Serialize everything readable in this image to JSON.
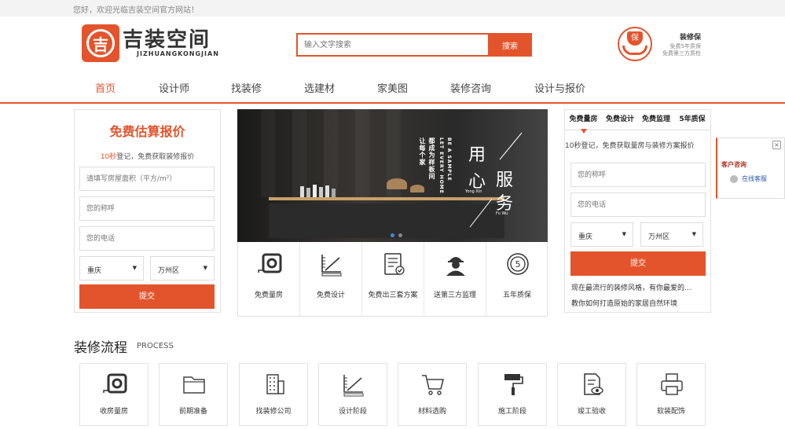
{
  "topbar": {
    "welcome": "您好，欢迎光临吉装空间官方网站！"
  },
  "logo": {
    "glyph": "吉",
    "name_cn": "吉装空间",
    "name_en": "JIZHUANGKONGJIAN"
  },
  "search": {
    "placeholder": "输入文字搜索",
    "button": "搜索"
  },
  "guarantee": {
    "badge": "保",
    "title": "装修保",
    "line1": "免费5年质保",
    "line2": "免费第三方质检"
  },
  "nav": {
    "items": [
      {
        "label": "首页",
        "active": true
      },
      {
        "label": "设计师"
      },
      {
        "label": "找装修"
      },
      {
        "label": "选建材"
      },
      {
        "label": "家美图"
      },
      {
        "label": "装修咨询"
      },
      {
        "label": "设计与报价"
      }
    ]
  },
  "left_form": {
    "title": "免费估算报价",
    "sub_highlight": "10秒",
    "sub_rest": "登记，免费获取装修报价",
    "area_placeholder": "请填写房屋面积（平方/m²）",
    "name_placeholder": "您的称呼",
    "phone_placeholder": "您的电话",
    "city": "重庆",
    "district": "万州区",
    "submit": "提交"
  },
  "banner": {
    "v1": "让每个家",
    "v2": "都成为样板间",
    "v3": "LET EVERY HOME",
    "v4": "BE A SAMPLE",
    "yong": "用",
    "xin": "心",
    "yong_xin_en": "Yong Xin",
    "fu": "服",
    "wu": "务",
    "fu_wu_en": "Fu Wu"
  },
  "services": [
    {
      "label": "免费量房",
      "icon": "tape-measure-icon"
    },
    {
      "label": "免费设计",
      "icon": "design-ruler-icon"
    },
    {
      "label": "免费出三套方案",
      "icon": "checklist-icon"
    },
    {
      "label": "送第三方监理",
      "icon": "supervisor-icon"
    },
    {
      "label": "五年质保",
      "icon": "five-year-badge-icon"
    }
  ],
  "right_form": {
    "tabs": [
      "免费量房",
      "免费设计",
      "免费监理",
      "5年质保"
    ],
    "sub": "10秒登记，免费获取量房与装修方案报价",
    "name_placeholder": "您的称呼",
    "phone_placeholder": "您的电话",
    "city": "重庆",
    "district": "万州区",
    "submit": "提交",
    "news": [
      "现在最流行的装修风格，有你最爱的...",
      "教你如何打造原始的家居自然环境"
    ]
  },
  "customer_service": {
    "title": "客户咨询",
    "online": "在线客服",
    "close": "×"
  },
  "process": {
    "title": "装修流程",
    "subtitle": "PROCESS",
    "steps": [
      {
        "label": "收房量房",
        "icon": "tape-measure-icon"
      },
      {
        "label": "前期准备",
        "icon": "folder-icon"
      },
      {
        "label": "找装修公司",
        "icon": "building-icon"
      },
      {
        "label": "设计阶段",
        "icon": "design-ruler-icon"
      },
      {
        "label": "材料选购",
        "icon": "cart-icon"
      },
      {
        "label": "施工阶段",
        "icon": "paint-roller-icon"
      },
      {
        "label": "竣工验收",
        "icon": "inspection-icon"
      },
      {
        "label": "软装配饰",
        "icon": "printer-icon"
      }
    ]
  },
  "colors": {
    "accent": "#e4542c"
  }
}
